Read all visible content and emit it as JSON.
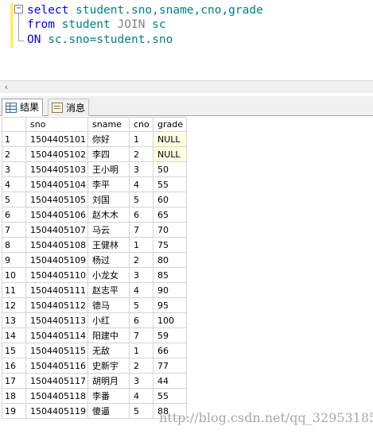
{
  "editor": {
    "line1": {
      "keyword": "select",
      "columns": "student.sno,sname,cno,grade"
    },
    "line2": {
      "keyword": "from",
      "table1": "student",
      "join": "JOIN",
      "table2": "sc"
    },
    "line3": {
      "keyword": "ON",
      "condition": "sc.sno=student.sno"
    },
    "collapse_symbol": "−"
  },
  "scrollbar": {
    "left_arrow": "‹"
  },
  "tabs": {
    "results_label": "结果",
    "messages_label": "消息"
  },
  "grid": {
    "columns": [
      "sno",
      "sname",
      "cno",
      "grade"
    ],
    "rows": [
      {
        "n": "1",
        "sno": "1504405101",
        "sname": "你好",
        "cno": "1",
        "grade": "NULL"
      },
      {
        "n": "2",
        "sno": "1504405102",
        "sname": "李四",
        "cno": "2",
        "grade": "NULL"
      },
      {
        "n": "3",
        "sno": "1504405103",
        "sname": "王小明",
        "cno": "3",
        "grade": "50"
      },
      {
        "n": "4",
        "sno": "1504405104",
        "sname": "李平",
        "cno": "4",
        "grade": "55"
      },
      {
        "n": "5",
        "sno": "1504405105",
        "sname": "刘国",
        "cno": "5",
        "grade": "60"
      },
      {
        "n": "6",
        "sno": "1504405106",
        "sname": "赵木木",
        "cno": "6",
        "grade": "65"
      },
      {
        "n": "7",
        "sno": "1504405107",
        "sname": "马云",
        "cno": "7",
        "grade": "70"
      },
      {
        "n": "8",
        "sno": "1504405108",
        "sname": "王健林",
        "cno": "1",
        "grade": "75"
      },
      {
        "n": "9",
        "sno": "1504405109",
        "sname": "杨过",
        "cno": "2",
        "grade": "80"
      },
      {
        "n": "10",
        "sno": "1504405110",
        "sname": "小龙女",
        "cno": "3",
        "grade": "85"
      },
      {
        "n": "11",
        "sno": "1504405111",
        "sname": "赵志平",
        "cno": "4",
        "grade": "90"
      },
      {
        "n": "12",
        "sno": "1504405112",
        "sname": "德马",
        "cno": "5",
        "grade": "95"
      },
      {
        "n": "13",
        "sno": "1504405113",
        "sname": "小红",
        "cno": "6",
        "grade": "100"
      },
      {
        "n": "14",
        "sno": "1504405114",
        "sname": "阳建中",
        "cno": "7",
        "grade": "59"
      },
      {
        "n": "15",
        "sno": "1504405115",
        "sname": "无敌",
        "cno": "1",
        "grade": "66"
      },
      {
        "n": "16",
        "sno": "1504405116",
        "sname": "史新宇",
        "cno": "2",
        "grade": "77"
      },
      {
        "n": "17",
        "sno": "1504405117",
        "sname": "胡明月",
        "cno": "3",
        "grade": "44"
      },
      {
        "n": "18",
        "sno": "1504405118",
        "sname": "李番",
        "cno": "4",
        "grade": "55"
      },
      {
        "n": "19",
        "sno": "1504405119",
        "sname": "傻逼",
        "cno": "5",
        "grade": "88"
      }
    ]
  },
  "watermark": "http://blog.csdn.net/qq_32953185",
  "colors": {
    "keyword": "#0000ff",
    "identifier": "#008080",
    "operator": "#808080",
    "null_highlight": "#ffffe1"
  }
}
